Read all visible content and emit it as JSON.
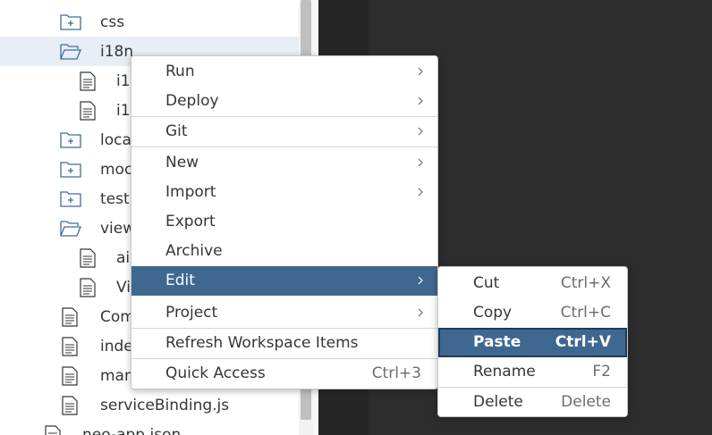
{
  "tree": {
    "items": [
      {
        "label": "css",
        "icon": "folder-plus-icon"
      },
      {
        "label": "i18n",
        "icon": "folder-open-icon"
      },
      {
        "label": "i1",
        "icon": "file-icon"
      },
      {
        "label": "i1",
        "icon": "file-icon"
      },
      {
        "label": "loca",
        "icon": "folder-plus-icon"
      },
      {
        "label": "moc",
        "icon": "folder-plus-icon"
      },
      {
        "label": "test",
        "icon": "folder-plus-icon"
      },
      {
        "label": "view",
        "icon": "folder-open-icon"
      },
      {
        "label": "ai",
        "icon": "file-icon"
      },
      {
        "label": "Vi",
        "icon": "file-icon"
      },
      {
        "label": "Com",
        "icon": "file-icon"
      },
      {
        "label": "inde",
        "icon": "file-icon"
      },
      {
        "label": "man",
        "icon": "file-icon"
      },
      {
        "label": "serviceBinding.js",
        "icon": "file-icon"
      },
      {
        "label": "neo-app.json",
        "icon": "file-icon"
      }
    ]
  },
  "context_menu": {
    "items": [
      {
        "label": "Run",
        "submenu": true
      },
      {
        "label": "Deploy",
        "submenu": true
      },
      {
        "label": "Git",
        "submenu": true
      },
      {
        "label": "New",
        "submenu": true
      },
      {
        "label": "Import",
        "submenu": true
      },
      {
        "label": "Export"
      },
      {
        "label": "Archive"
      },
      {
        "label": "Edit",
        "submenu": true,
        "highlighted": true
      },
      {
        "label": "Project",
        "submenu": true
      },
      {
        "label": "Refresh Workspace Items"
      },
      {
        "label": "Quick Access",
        "shortcut": "Ctrl+3"
      }
    ]
  },
  "edit_submenu": {
    "items": [
      {
        "label": "Cut",
        "shortcut": "Ctrl+X"
      },
      {
        "label": "Copy",
        "shortcut": "Ctrl+C"
      },
      {
        "label": "Paste",
        "shortcut": "Ctrl+V",
        "highlighted": true
      },
      {
        "label": "Rename",
        "shortcut": "F2"
      },
      {
        "label": "Delete",
        "shortcut": "Delete"
      }
    ]
  },
  "colors": {
    "highlight": "#3f6890",
    "icon_blue": "#3b6e9c",
    "editor_bg": "#2d2d2d"
  }
}
